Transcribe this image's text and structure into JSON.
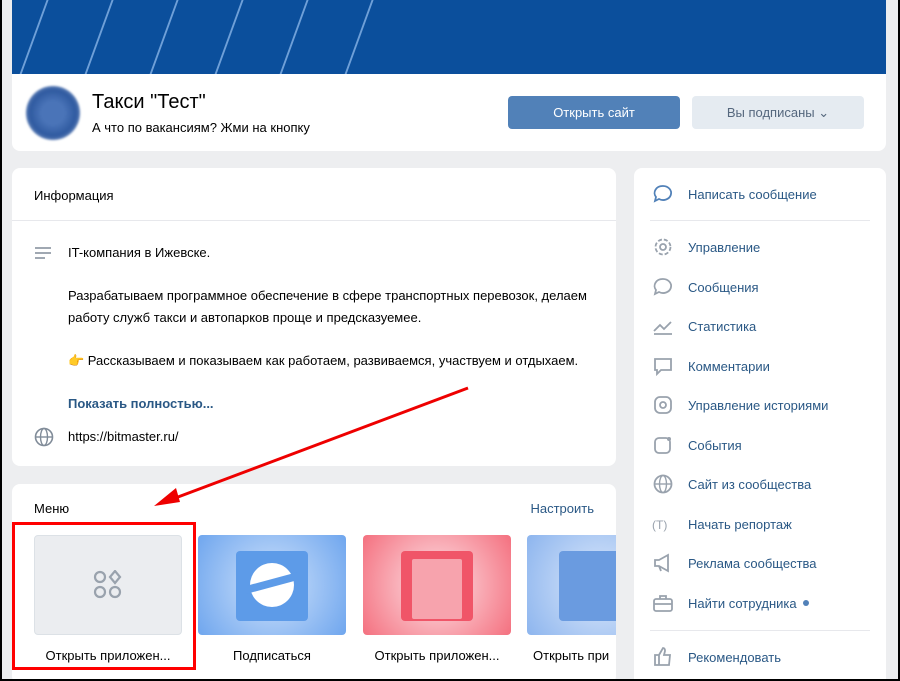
{
  "group": {
    "name": "Такси \"Тест\"",
    "status": "А что по вакансиям? Жми на кнопку",
    "open_site": "Открыть сайт",
    "subscribed": "Вы подписаны"
  },
  "info": {
    "title": "Информация",
    "lines": [
      "IT-компания в Ижевске.",
      "Разрабатываем программное обеспечение в сфере транспортных перевозок, делаем работу служб такси и автопарков проще и предсказуемее.",
      "👉 Рассказываем и показываем как работаем, развиваемся, участвуем и отдыхаем."
    ],
    "show_more": "Показать полностью...",
    "site": "https://bitmaster.ru/"
  },
  "menu": {
    "title": "Меню",
    "setup": "Настроить",
    "items": [
      {
        "label": "Открыть приложен..."
      },
      {
        "label": "Подписаться"
      },
      {
        "label": "Открыть приложен..."
      },
      {
        "label": "Открыть при"
      }
    ]
  },
  "sidebar": {
    "items": [
      {
        "label": "Написать сообщение",
        "icon": "message-icon"
      },
      {
        "label": "Управление",
        "icon": "gear-icon"
      },
      {
        "label": "Сообщения",
        "icon": "chat-icon"
      },
      {
        "label": "Статистика",
        "icon": "chart-icon"
      },
      {
        "label": "Комментарии",
        "icon": "comment-icon"
      },
      {
        "label": "Управление историями",
        "icon": "stories-icon"
      },
      {
        "label": "События",
        "icon": "event-icon"
      },
      {
        "label": "Сайт из сообщества",
        "icon": "globe-icon"
      },
      {
        "label": "Начать репортаж",
        "icon": "live-icon"
      },
      {
        "label": "Реклама сообщества",
        "icon": "megaphone-icon"
      },
      {
        "label": "Найти сотрудника",
        "icon": "briefcase-icon"
      },
      {
        "label": "Рекомендовать",
        "icon": "thumbs-up-icon"
      }
    ]
  },
  "colors": {
    "accent": "#5181b8",
    "link": "#2a5885",
    "cover": "#0b4f9c",
    "highlight": "#ff0000"
  }
}
